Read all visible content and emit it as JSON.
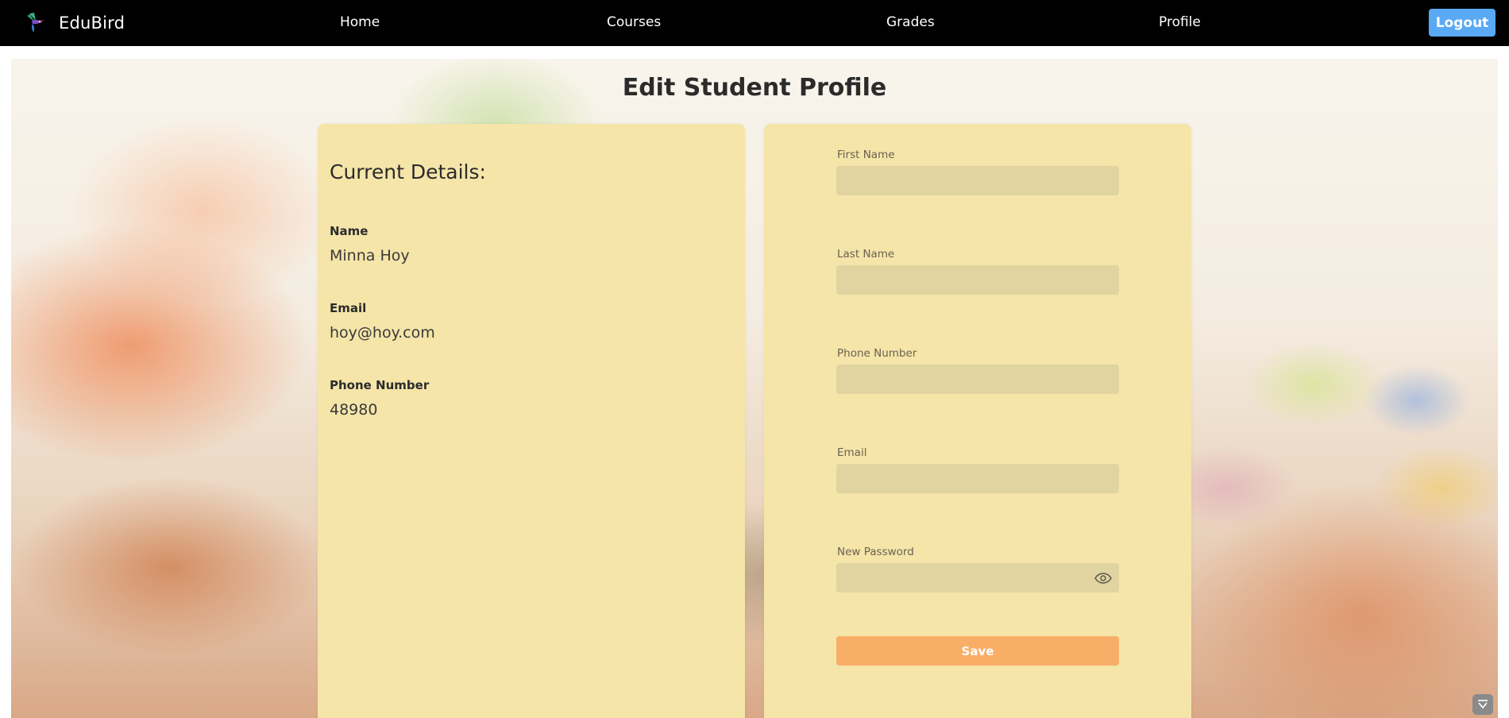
{
  "nav": {
    "brand": "EduBird",
    "links": [
      "Home",
      "Courses",
      "Grades",
      "Profile"
    ],
    "logout": "Logout"
  },
  "page": {
    "title": "Edit Student Profile"
  },
  "current_details": {
    "heading": "Current Details:",
    "name_label": "Name",
    "name_value": "Minna Hoy",
    "email_label": "Email",
    "email_value": "hoy@hoy.com",
    "phone_label": "Phone Number",
    "phone_value": "48980"
  },
  "form": {
    "first_name_label": "First Name",
    "first_name_value": "",
    "last_name_label": "Last Name",
    "last_name_value": "",
    "phone_label": "Phone Number",
    "phone_value": "",
    "email_label": "Email",
    "email_value": "",
    "password_label": "New Password",
    "password_value": "",
    "save": "Save"
  },
  "icons": {
    "logo": "hummingbird-logo-icon",
    "password_toggle": "eye-icon",
    "corner_widget": "chevron-down-widget-icon"
  },
  "colors": {
    "navbar": "#000000",
    "logout": "#5aa9f4",
    "card": "#f5e5a9",
    "input": "#e1d4a1",
    "save": "#f9ae68"
  }
}
